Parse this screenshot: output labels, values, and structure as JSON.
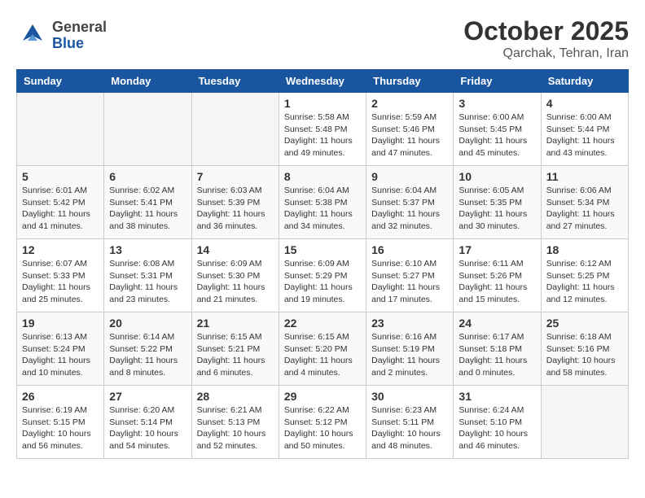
{
  "header": {
    "logo_general": "General",
    "logo_blue": "Blue",
    "month": "October 2025",
    "location": "Qarchak, Tehran, Iran"
  },
  "weekdays": [
    "Sunday",
    "Monday",
    "Tuesday",
    "Wednesday",
    "Thursday",
    "Friday",
    "Saturday"
  ],
  "weeks": [
    [
      {
        "day": "",
        "info": ""
      },
      {
        "day": "",
        "info": ""
      },
      {
        "day": "",
        "info": ""
      },
      {
        "day": "1",
        "sunrise": "Sunrise: 5:58 AM",
        "sunset": "Sunset: 5:48 PM",
        "daylight": "Daylight: 11 hours and 49 minutes."
      },
      {
        "day": "2",
        "sunrise": "Sunrise: 5:59 AM",
        "sunset": "Sunset: 5:46 PM",
        "daylight": "Daylight: 11 hours and 47 minutes."
      },
      {
        "day": "3",
        "sunrise": "Sunrise: 6:00 AM",
        "sunset": "Sunset: 5:45 PM",
        "daylight": "Daylight: 11 hours and 45 minutes."
      },
      {
        "day": "4",
        "sunrise": "Sunrise: 6:00 AM",
        "sunset": "Sunset: 5:44 PM",
        "daylight": "Daylight: 11 hours and 43 minutes."
      }
    ],
    [
      {
        "day": "5",
        "sunrise": "Sunrise: 6:01 AM",
        "sunset": "Sunset: 5:42 PM",
        "daylight": "Daylight: 11 hours and 41 minutes."
      },
      {
        "day": "6",
        "sunrise": "Sunrise: 6:02 AM",
        "sunset": "Sunset: 5:41 PM",
        "daylight": "Daylight: 11 hours and 38 minutes."
      },
      {
        "day": "7",
        "sunrise": "Sunrise: 6:03 AM",
        "sunset": "Sunset: 5:39 PM",
        "daylight": "Daylight: 11 hours and 36 minutes."
      },
      {
        "day": "8",
        "sunrise": "Sunrise: 6:04 AM",
        "sunset": "Sunset: 5:38 PM",
        "daylight": "Daylight: 11 hours and 34 minutes."
      },
      {
        "day": "9",
        "sunrise": "Sunrise: 6:04 AM",
        "sunset": "Sunset: 5:37 PM",
        "daylight": "Daylight: 11 hours and 32 minutes."
      },
      {
        "day": "10",
        "sunrise": "Sunrise: 6:05 AM",
        "sunset": "Sunset: 5:35 PM",
        "daylight": "Daylight: 11 hours and 30 minutes."
      },
      {
        "day": "11",
        "sunrise": "Sunrise: 6:06 AM",
        "sunset": "Sunset: 5:34 PM",
        "daylight": "Daylight: 11 hours and 27 minutes."
      }
    ],
    [
      {
        "day": "12",
        "sunrise": "Sunrise: 6:07 AM",
        "sunset": "Sunset: 5:33 PM",
        "daylight": "Daylight: 11 hours and 25 minutes."
      },
      {
        "day": "13",
        "sunrise": "Sunrise: 6:08 AM",
        "sunset": "Sunset: 5:31 PM",
        "daylight": "Daylight: 11 hours and 23 minutes."
      },
      {
        "day": "14",
        "sunrise": "Sunrise: 6:09 AM",
        "sunset": "Sunset: 5:30 PM",
        "daylight": "Daylight: 11 hours and 21 minutes."
      },
      {
        "day": "15",
        "sunrise": "Sunrise: 6:09 AM",
        "sunset": "Sunset: 5:29 PM",
        "daylight": "Daylight: 11 hours and 19 minutes."
      },
      {
        "day": "16",
        "sunrise": "Sunrise: 6:10 AM",
        "sunset": "Sunset: 5:27 PM",
        "daylight": "Daylight: 11 hours and 17 minutes."
      },
      {
        "day": "17",
        "sunrise": "Sunrise: 6:11 AM",
        "sunset": "Sunset: 5:26 PM",
        "daylight": "Daylight: 11 hours and 15 minutes."
      },
      {
        "day": "18",
        "sunrise": "Sunrise: 6:12 AM",
        "sunset": "Sunset: 5:25 PM",
        "daylight": "Daylight: 11 hours and 12 minutes."
      }
    ],
    [
      {
        "day": "19",
        "sunrise": "Sunrise: 6:13 AM",
        "sunset": "Sunset: 5:24 PM",
        "daylight": "Daylight: 11 hours and 10 minutes."
      },
      {
        "day": "20",
        "sunrise": "Sunrise: 6:14 AM",
        "sunset": "Sunset: 5:22 PM",
        "daylight": "Daylight: 11 hours and 8 minutes."
      },
      {
        "day": "21",
        "sunrise": "Sunrise: 6:15 AM",
        "sunset": "Sunset: 5:21 PM",
        "daylight": "Daylight: 11 hours and 6 minutes."
      },
      {
        "day": "22",
        "sunrise": "Sunrise: 6:15 AM",
        "sunset": "Sunset: 5:20 PM",
        "daylight": "Daylight: 11 hours and 4 minutes."
      },
      {
        "day": "23",
        "sunrise": "Sunrise: 6:16 AM",
        "sunset": "Sunset: 5:19 PM",
        "daylight": "Daylight: 11 hours and 2 minutes."
      },
      {
        "day": "24",
        "sunrise": "Sunrise: 6:17 AM",
        "sunset": "Sunset: 5:18 PM",
        "daylight": "Daylight: 11 hours and 0 minutes."
      },
      {
        "day": "25",
        "sunrise": "Sunrise: 6:18 AM",
        "sunset": "Sunset: 5:16 PM",
        "daylight": "Daylight: 10 hours and 58 minutes."
      }
    ],
    [
      {
        "day": "26",
        "sunrise": "Sunrise: 6:19 AM",
        "sunset": "Sunset: 5:15 PM",
        "daylight": "Daylight: 10 hours and 56 minutes."
      },
      {
        "day": "27",
        "sunrise": "Sunrise: 6:20 AM",
        "sunset": "Sunset: 5:14 PM",
        "daylight": "Daylight: 10 hours and 54 minutes."
      },
      {
        "day": "28",
        "sunrise": "Sunrise: 6:21 AM",
        "sunset": "Sunset: 5:13 PM",
        "daylight": "Daylight: 10 hours and 52 minutes."
      },
      {
        "day": "29",
        "sunrise": "Sunrise: 6:22 AM",
        "sunset": "Sunset: 5:12 PM",
        "daylight": "Daylight: 10 hours and 50 minutes."
      },
      {
        "day": "30",
        "sunrise": "Sunrise: 6:23 AM",
        "sunset": "Sunset: 5:11 PM",
        "daylight": "Daylight: 10 hours and 48 minutes."
      },
      {
        "day": "31",
        "sunrise": "Sunrise: 6:24 AM",
        "sunset": "Sunset: 5:10 PM",
        "daylight": "Daylight: 10 hours and 46 minutes."
      },
      {
        "day": "",
        "info": ""
      }
    ]
  ]
}
